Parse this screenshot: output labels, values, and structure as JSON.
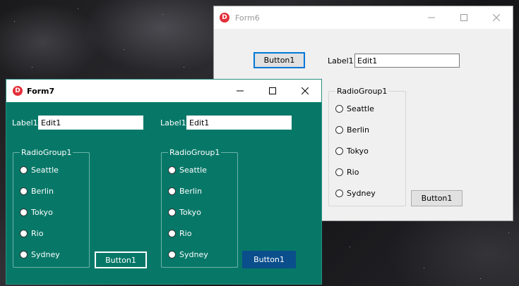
{
  "form6": {
    "title": "Form6",
    "app_icon_letter": "D",
    "button_top": "Button1",
    "label": "Label1",
    "edit_value": "Edit1",
    "radiogroup": {
      "caption": "RadioGroup1",
      "items": [
        "Seattle",
        "Berlin",
        "Tokyo",
        "Rio",
        "Sydney"
      ]
    },
    "button_bottom": "Button1"
  },
  "form7": {
    "title": "Form7",
    "app_icon_letter": "D",
    "left_panel": {
      "label": "Label1",
      "edit_value": "Edit1",
      "radiogroup": {
        "caption": "RadioGroup1",
        "items": [
          "Seattle",
          "Berlin",
          "Tokyo",
          "Rio",
          "Sydney"
        ]
      },
      "button": "Button1"
    },
    "right_panel": {
      "label": "Label1",
      "edit_value": "Edit1",
      "radiogroup": {
        "caption": "RadioGroup1",
        "items": [
          "Seattle",
          "Berlin",
          "Tokyo",
          "Rio",
          "Sydney"
        ]
      },
      "button": "Button1"
    }
  },
  "colors": {
    "form7_background": "#077868",
    "form6_background": "#f0f0f0",
    "focused_button_border": "#0078d7",
    "blue_button": "#0a4e8c",
    "app_icon_red": "#e3303a"
  },
  "icons": {
    "minimize": "minimize-icon",
    "maximize": "maximize-icon",
    "close": "close-icon",
    "app": "delphi-app-icon"
  }
}
